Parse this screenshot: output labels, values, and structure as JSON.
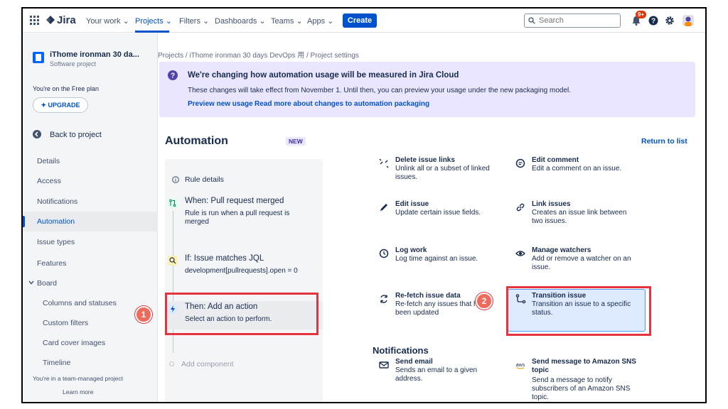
{
  "topnav": {
    "product": "Jira",
    "items": [
      {
        "label": "Your work ⌄"
      },
      {
        "label": "Projects ⌄"
      },
      {
        "label": "Filters ⌄"
      },
      {
        "label": "Dashboards ⌄"
      },
      {
        "label": "Teams ⌄"
      },
      {
        "label": "Apps ⌄"
      }
    ],
    "create_label": "Create",
    "search_placeholder": "Search",
    "notification_badge": "9+",
    "accent": "#0052cc"
  },
  "sidebar": {
    "project_name": "iThome ironman 30 da...",
    "project_type": "Software project",
    "plan_text": "You're on the Free plan",
    "upgrade_label": "UPGRADE",
    "back_label": "Back to project",
    "items": [
      {
        "label": "Details"
      },
      {
        "label": "Access"
      },
      {
        "label": "Notifications"
      },
      {
        "label": "Automation"
      },
      {
        "label": "Issue types"
      },
      {
        "label": "Features"
      },
      {
        "label": "Board"
      },
      {
        "label": "Columns and statuses"
      },
      {
        "label": "Custom filters"
      },
      {
        "label": "Card cover images"
      },
      {
        "label": "Timeline"
      }
    ],
    "footer_text": "You're in a team-managed project",
    "learn_more": "Learn more"
  },
  "breadcrumb": "Projects  /  iThome ironman 30 days DevOps 用  /  Project settings",
  "banner": {
    "title": "We're changing how automation usage will be measured in Jira Cloud",
    "body": "These changes will take effect from November 1. Until then, you can preview your usage under the new packaging model.",
    "link1": "Preview new usage",
    "separator": "·",
    "link2": "Read more about changes to automation packaging"
  },
  "automation": {
    "title": "Automation",
    "badge": "NEW",
    "return_label": "Return to list",
    "rule_details": "Rule details",
    "steps": [
      {
        "title": "When: Pull request merged",
        "desc": "Rule is run when a pull request is merged"
      },
      {
        "title": "If: Issue matches JQL",
        "desc": "development[pullrequests].open = 0"
      },
      {
        "title": "Then: Add an action",
        "desc": "Select an action to perform."
      }
    ],
    "add_component": "Add component"
  },
  "actions": [
    {
      "title": "Delete issue links",
      "desc": "Unlink all or a subset of linked issues.",
      "icon": "unlink-icon"
    },
    {
      "title": "Edit comment",
      "desc": "Edit a comment on an issue.",
      "icon": "comment-icon"
    },
    {
      "title": "Edit issue",
      "desc": "Update certain issue fields.",
      "icon": "pencil-icon"
    },
    {
      "title": "Link issues",
      "desc": "Creates an issue link between two issues.",
      "icon": "link-icon"
    },
    {
      "title": "Log work",
      "desc": "Log time against an issue.",
      "icon": "clock-icon"
    },
    {
      "title": "Manage watchers",
      "desc": "Add or remove a watcher on an issue.",
      "icon": "eye-icon"
    },
    {
      "title": "Re-fetch issue data",
      "desc": "Re-fetch any issues that have been updated",
      "icon": "refresh-icon"
    },
    {
      "title": "Transition issue",
      "desc": "Transition an issue to a specific status.",
      "icon": "transition-icon"
    }
  ],
  "notifications": {
    "title": "Notifications",
    "items": [
      {
        "title": "Send email",
        "desc": "Sends an email to a given address.",
        "icon": "email-icon"
      },
      {
        "title": "Send message to Amazon SNS topic",
        "desc": "Send a message to notify subscribers of an Amazon SNS topic.",
        "icon": "aws-icon"
      }
    ]
  },
  "callouts": {
    "one": "1",
    "two": "2",
    "color": "#e5343d"
  }
}
